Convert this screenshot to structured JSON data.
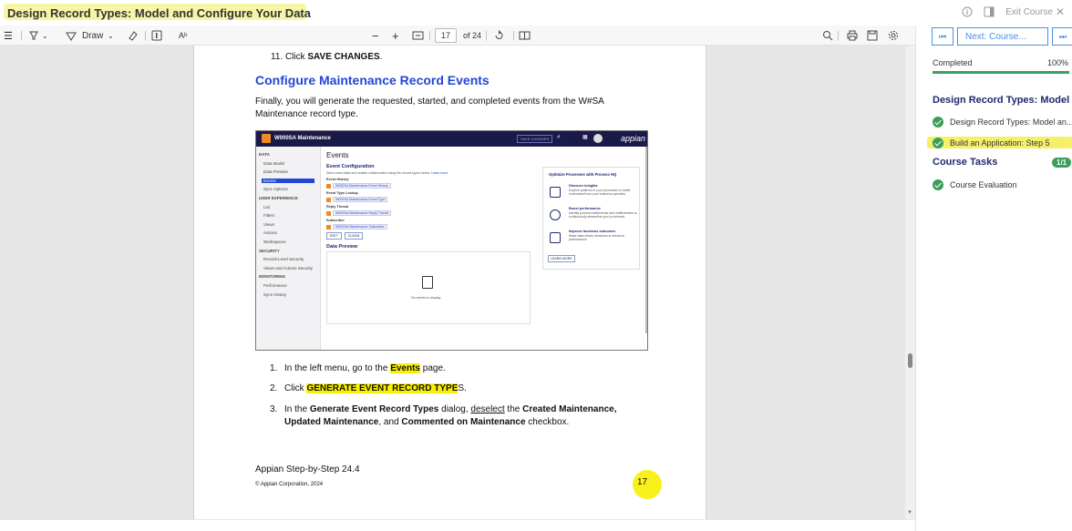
{
  "header": {
    "title": "Design Record Types: Model and Configure Your Data",
    "exit_label": "Exit Course"
  },
  "toolbar": {
    "draw_label": "Draw",
    "page_current": "17",
    "page_total": "of 24"
  },
  "document": {
    "step_11_prefix": "11. Click ",
    "step_11_bold": "SAVE CHANGES",
    "step_11_suffix": ".",
    "heading": "Configure Maintenance Record Events",
    "intro_line1": "Finally, you will generate the requested, started, and completed events from the W#SA",
    "intro_line2": "Maintenance record type.",
    "list": [
      {
        "num": "1.",
        "pre": "In the left menu, go to the ",
        "bold": "Events",
        "post": " page."
      },
      {
        "num": "2.",
        "pre": "Click ",
        "bold": "GENERATE EVENT RECORD TYPE",
        "post": "S."
      },
      {
        "num": "3.",
        "pre": "In the ",
        "bold": "Generate Event Record Types",
        "mid": " dialog, ",
        "under": "deselect",
        "mid2": " the ",
        "bold2": "Created Maintenance,",
        "line2_bold": "Updated Maintenance",
        "line2_mid": ", and ",
        "line2_bold2": "Commented on Maintenance",
        "line2_post": " checkbox."
      }
    ],
    "footer_title": "Appian Step-by-Step 24.4",
    "footer_copy": "© Appian Corporation, 2024",
    "page_number": "17"
  },
  "embedded": {
    "app_title": "W000SA Maintenance",
    "save_btn": "SAVE CHANGES",
    "brand": "appian",
    "side_items": [
      {
        "label": "DATA",
        "head": true
      },
      {
        "label": "Data Model"
      },
      {
        "label": "Data Preview"
      },
      {
        "label": "Events",
        "active": true
      },
      {
        "label": "Sync Options"
      },
      {
        "label": "USER EXPERIENCE",
        "head": true
      },
      {
        "label": "List"
      },
      {
        "label": "Filters"
      },
      {
        "label": "Views"
      },
      {
        "label": "Actions"
      },
      {
        "label": "Workspaces"
      },
      {
        "label": "SECURITY",
        "head": true
      },
      {
        "label": "Record-Level Security"
      },
      {
        "label": "Views and Actions Security"
      },
      {
        "label": "MONITORING",
        "head": true
      },
      {
        "label": "Performance"
      },
      {
        "label": "Sync History"
      }
    ],
    "page_title": "Events",
    "config_title": "Event Configuration",
    "config_desc": "Store event data and enable collaboration using the record types below.",
    "learn_more": "Learn more",
    "fields": [
      {
        "label": "Event History",
        "value": "W000SA Maintenance Event History"
      },
      {
        "label": "Event Type Lookup",
        "value": "W000SA Maintenance Event Type"
      },
      {
        "label": "Reply Thread",
        "value": "W000SA Maintenance Reply Thread"
      },
      {
        "label": "Subscriber",
        "value": "W000SA Maintenance Subscriber"
      }
    ],
    "edit_btn": "EDIT",
    "clear_btn": "CLEAR",
    "preview_title": "Data Preview",
    "no_events": "No events to display",
    "promo_title": "Optimize Processes with Process HQ",
    "promo_items": [
      {
        "title": "Discover insights",
        "text": "Explore patterns in your processes to better understand how your business operates"
      },
      {
        "title": "Boost performance",
        "text": "Identify process bottlenecks and inefficiencies to continuously streamline your processes"
      },
      {
        "title": "Improve business outcomes",
        "text": "Make data-driven decisions to enhance performance"
      }
    ],
    "promo_btn": "LEARN MORE"
  },
  "sidebar": {
    "next_label": "Next: Course...",
    "progress_label": "Completed",
    "progress_value": "100%",
    "progress_fraction": 1.0,
    "module_title": "Design Record Types: Model an",
    "items": [
      {
        "label": "Design Record Types: Model an..."
      },
      {
        "label": "Build an Application: Step 5"
      }
    ],
    "tasks_title": "Course Tasks",
    "tasks_badge": "1/1",
    "task_items": [
      {
        "label": "Course Evaluation"
      }
    ]
  }
}
